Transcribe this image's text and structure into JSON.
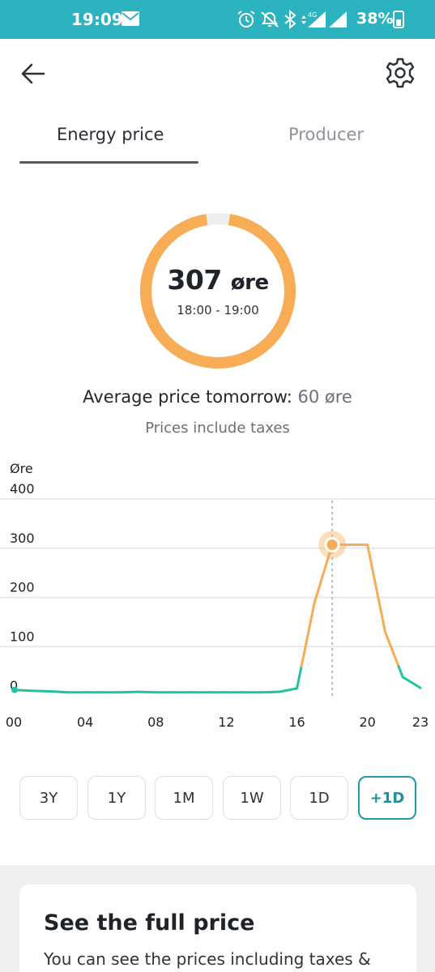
{
  "status_bar": {
    "time": "19:09",
    "battery": "38%",
    "background_color": "#2bb3c0",
    "icons": [
      "mail-icon",
      "alarm-icon",
      "bell-off-icon",
      "bluetooth-icon",
      "data-arrows-icon",
      "signal-4g-icon",
      "signal-roaming-icon",
      "battery-icon"
    ],
    "network_badge": "4G"
  },
  "header": {
    "back_icon": "arrow-left-icon",
    "settings_icon": "gear-icon"
  },
  "tabs": [
    {
      "label": "Energy price",
      "active": true
    },
    {
      "label": "Producer",
      "active": false
    }
  ],
  "current_price": {
    "value": "307",
    "unit": "øre",
    "time_range": "18:00 - 19:00",
    "ring_fill_fraction": 0.95,
    "ring_color": "#f7ac55"
  },
  "average": {
    "label": "Average price tomorrow:",
    "value": "60 øre"
  },
  "tax_note": "Prices include taxes",
  "chart_data": {
    "type": "line",
    "ylabel": "Øre",
    "ylim": [
      0,
      400
    ],
    "y_ticks": [
      "0",
      "100",
      "200",
      "300",
      "400"
    ],
    "x_ticks": [
      "00",
      "04",
      "08",
      "12",
      "16",
      "20",
      "23"
    ],
    "grid": true,
    "x": [
      0,
      1,
      2,
      3,
      4,
      5,
      6,
      7,
      8,
      9,
      10,
      11,
      12,
      13,
      14,
      15,
      16,
      17,
      18,
      19,
      20,
      21,
      22,
      23
    ],
    "values": [
      12,
      10,
      9,
      7,
      7,
      7,
      7,
      8,
      7,
      7,
      7,
      7,
      7,
      7,
      7,
      8,
      15,
      190,
      307,
      307,
      307,
      130,
      38,
      16
    ],
    "selected_hour": 18,
    "high_color": "#f7ac55",
    "low_color": "#22c3a2",
    "low_threshold": 60
  },
  "periods": [
    {
      "label": "3Y",
      "active": false
    },
    {
      "label": "1Y",
      "active": false
    },
    {
      "label": "1M",
      "active": false
    },
    {
      "label": "1W",
      "active": false
    },
    {
      "label": "1D",
      "active": false
    },
    {
      "label": "+1D",
      "active": true
    }
  ],
  "promo_card": {
    "title": "See the full price",
    "text": "You can see the prices including taxes &"
  }
}
